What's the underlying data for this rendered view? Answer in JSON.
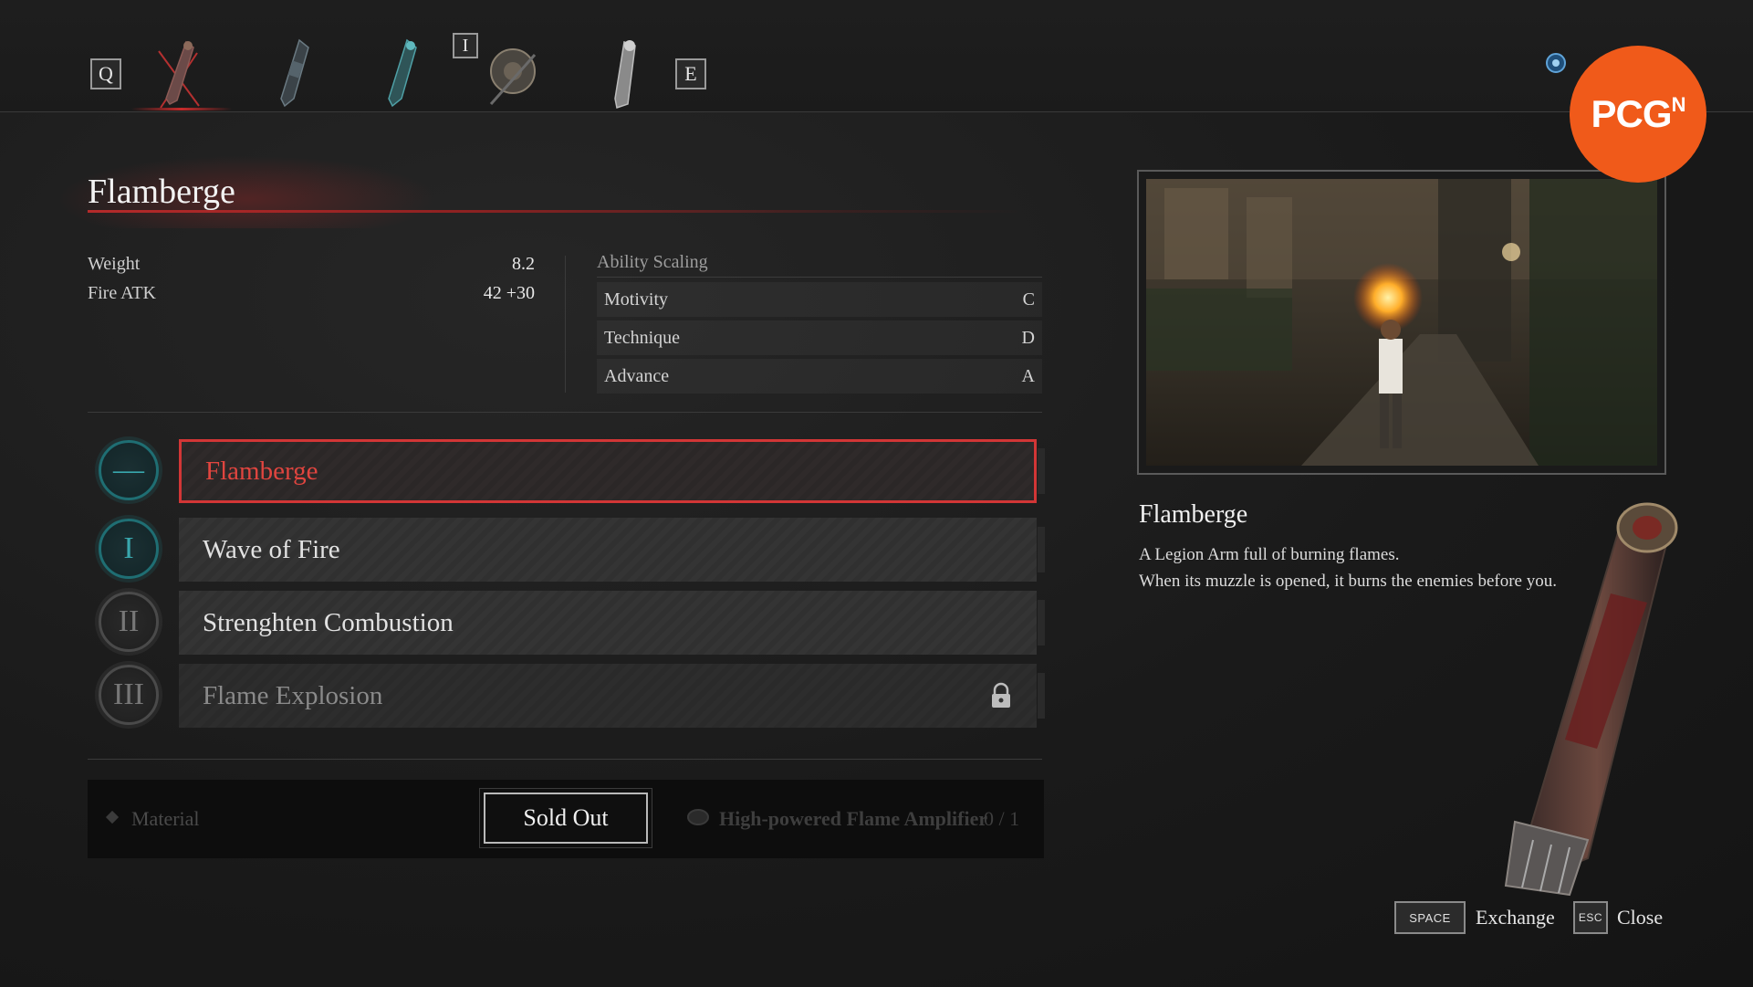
{
  "nav": {
    "prev_key": "Q",
    "next_key": "E",
    "marker_key": "I",
    "slots": [
      "flamberge-arm-icon",
      "arm-weapon-icon",
      "arm-weapon-icon",
      "shield-arm-icon",
      "arm-weapon-icon"
    ]
  },
  "weapon": {
    "name": "Flamberge",
    "stats": [
      {
        "label": "Weight",
        "value": "8.2"
      },
      {
        "label": "Fire ATK",
        "value": "42 +30"
      }
    ],
    "scaling_title": "Ability Scaling",
    "scaling": [
      {
        "label": "Motivity",
        "grade": "C"
      },
      {
        "label": "Technique",
        "grade": "D"
      },
      {
        "label": "Advance",
        "grade": "A"
      }
    ]
  },
  "skills": [
    {
      "badge": "—",
      "name": "Flamberge",
      "state": "selected"
    },
    {
      "badge": "I",
      "name": "Wave of Fire",
      "state": "unlocked"
    },
    {
      "badge": "II",
      "name": "Strenghten Combustion",
      "state": "unlocked"
    },
    {
      "badge": "III",
      "name": "Flame Explosion",
      "state": "locked"
    }
  ],
  "material": {
    "label": "Material",
    "button": "Sold Out",
    "item_name": "High-powered Flame Amplifier",
    "count": "0 / 1"
  },
  "details": {
    "title": "Flamberge",
    "lines": [
      "A Legion Arm full of burning flames.",
      "When its muzzle is opened, it burns the enemies before you."
    ]
  },
  "footer": {
    "exchange_key": "SPACE",
    "exchange_label": "Exchange",
    "close_key": "ESC",
    "close_label": "Close"
  },
  "logo": {
    "text": "PCG",
    "sup": "N"
  },
  "colors": {
    "accent_red": "#d23636",
    "teal": "#39a7ad",
    "logo_orange": "#f05a1a"
  }
}
